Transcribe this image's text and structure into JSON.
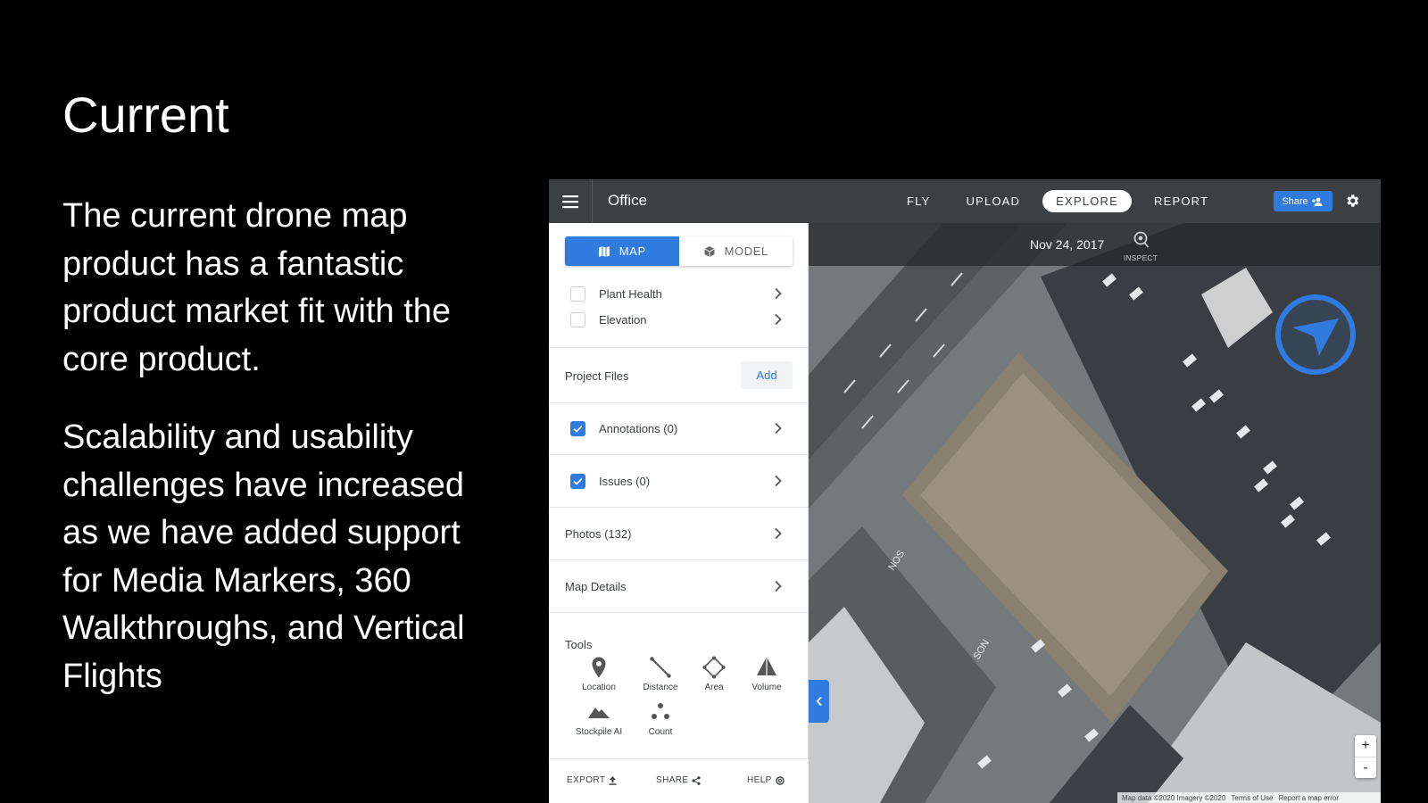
{
  "slide": {
    "title": "Current",
    "paragraphs": [
      "The current drone map product has a fantastic product market fit with the core product.",
      "Scalability and usability challenges have increased as we have added support for Media Markers, 360 Walkthroughs, and Vertical Flights"
    ]
  },
  "app": {
    "title": "Office",
    "nav": [
      "FLY",
      "UPLOAD",
      "EXPLORE",
      "REPORT"
    ],
    "active_nav": "EXPLORE",
    "share_label": "Share",
    "accent": "#2f7be0"
  },
  "sidebar": {
    "view_toggle": {
      "map": "MAP",
      "model": "MODEL",
      "active": "MAP"
    },
    "layers": [
      {
        "label": "Plant Health",
        "checked": false
      },
      {
        "label": "Elevation",
        "checked": false
      }
    ],
    "project_files": {
      "label": "Project Files",
      "add_label": "Add"
    },
    "annotations": {
      "label": "Annotations (0)",
      "checked": true
    },
    "issues": {
      "label": "Issues (0)",
      "checked": true
    },
    "photos": "Photos (132)",
    "map_details": "Map Details",
    "tools_label": "Tools",
    "tools": [
      "Location",
      "Distance",
      "Area",
      "Volume",
      "Stockpile AI",
      "Count"
    ],
    "footer": {
      "export": "EXPORT",
      "share": "SHARE",
      "help": "HELP"
    }
  },
  "map": {
    "date": "Nov 24, 2017",
    "inspect_label": "INSPECT",
    "zoom_in": "+",
    "zoom_out": "-",
    "attribution": [
      "Map data ©2020 Imagery ©2020",
      "Terms of Use",
      "Report a map error"
    ],
    "street_labels": [
      "NOS",
      "SON"
    ]
  }
}
